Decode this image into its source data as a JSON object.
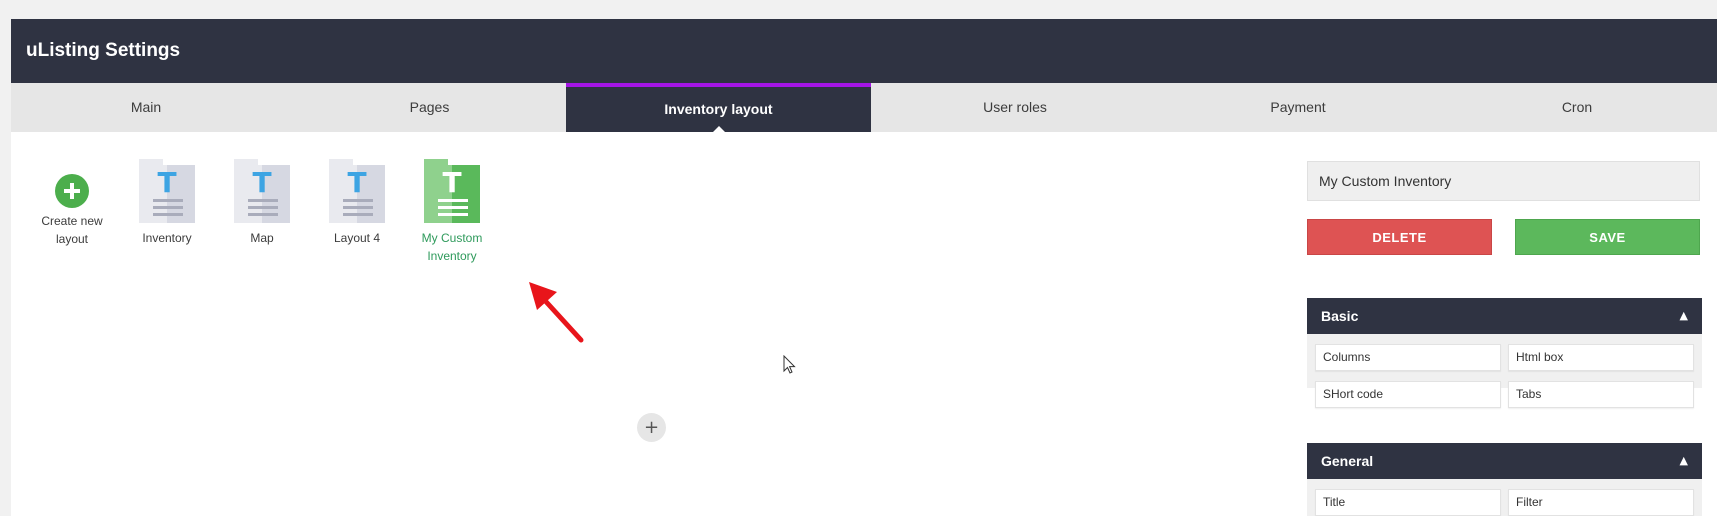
{
  "app": {
    "title": "uListing Settings"
  },
  "tabs": [
    {
      "label": "Main"
    },
    {
      "label": "Pages"
    },
    {
      "label": "Inventory layout"
    },
    {
      "label": "User roles"
    },
    {
      "label": "Payment"
    },
    {
      "label": "Cron"
    }
  ],
  "active_tab": "Inventory layout",
  "create_new": {
    "label": "Create new layout",
    "icon": "plus-circle-icon"
  },
  "layouts": [
    {
      "label": "Inventory",
      "icon": "layout-doc-icon"
    },
    {
      "label": "Map",
      "icon": "layout-doc-icon"
    },
    {
      "label": "Layout 4",
      "icon": "layout-doc-icon"
    },
    {
      "label": "My Custom Inventory",
      "icon": "layout-doc-icon",
      "selected": true
    }
  ],
  "canvas": {
    "add_row_icon": "plus-icon",
    "add_row_glyph": "+"
  },
  "sidebar": {
    "layout_name_value": "My Custom Inventory",
    "delete_label": "DELETE",
    "save_label": "SAVE",
    "sections": [
      {
        "title": "Basic",
        "items": [
          "Columns",
          "Html box",
          "SHort code",
          "Tabs"
        ]
      },
      {
        "title": "General",
        "items": [
          "Title",
          "Filter"
        ]
      }
    ]
  },
  "colors": {
    "header_bg": "#2f3342",
    "tab_active_accent": "#a515e6",
    "delete": "#de5353",
    "save": "#5cb85c",
    "selected_label": "#2e9a5b",
    "annotation_arrow": "#e8151b"
  }
}
